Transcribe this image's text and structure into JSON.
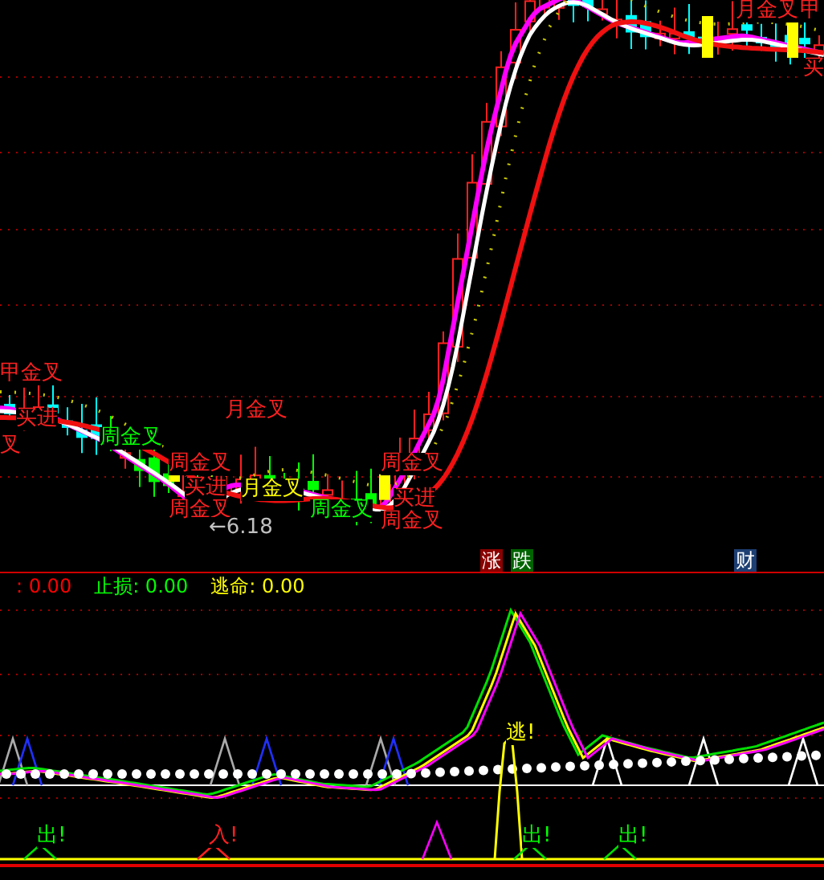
{
  "main_chart": {
    "labels": [
      {
        "text": "甲金叉",
        "color": "#ff2020"
      },
      {
        "text": "买进",
        "color": "#ff2020"
      },
      {
        "text": "叉",
        "color": "#ff2020"
      },
      {
        "text": "周金叉",
        "color": "#00ff00"
      },
      {
        "text": "月金叉",
        "color": "#ff2020"
      },
      {
        "text": "周金叉",
        "color": "#ff2020"
      },
      {
        "text": "买进",
        "color": "#ff2020"
      },
      {
        "text": "周金叉",
        "color": "#ff2020"
      },
      {
        "text": "←6.18",
        "color": "#c0c0c0"
      },
      {
        "text": "月金叉",
        "color": "#ffff00"
      },
      {
        "text": "周金叉",
        "color": "#00ff00"
      },
      {
        "text": "周金叉",
        "color": "#ff2020"
      },
      {
        "text": "买进",
        "color": "#ff2020"
      },
      {
        "text": "周金叉",
        "color": "#ff2020"
      },
      {
        "text": "月金叉",
        "color": "#ff2020"
      },
      {
        "text": "甲",
        "color": "#ff2020"
      },
      {
        "text": "买",
        "color": "#ff2020"
      }
    ],
    "tags": [
      {
        "text": "涨",
        "color": "#8b0000"
      },
      {
        "text": "跌",
        "color": "#006400"
      },
      {
        "text": "财",
        "color": "#1d3f73"
      }
    ]
  },
  "indicator": {
    "items": [
      {
        "text": ": 0.00",
        "color": "#ff0000"
      },
      {
        "text": "止损: 0.00",
        "color": "#00ff00"
      },
      {
        "text": "逃命: 0.00",
        "color": "#ffff00"
      }
    ],
    "labels": [
      {
        "text": "逃!",
        "color": "#ffff00"
      },
      {
        "text": "出!",
        "color": "#00ff00"
      },
      {
        "text": "入!",
        "color": "#ff2020"
      },
      {
        "text": "出!",
        "color": "#00ff00"
      },
      {
        "text": "出!",
        "color": "#00ff00"
      }
    ]
  }
}
